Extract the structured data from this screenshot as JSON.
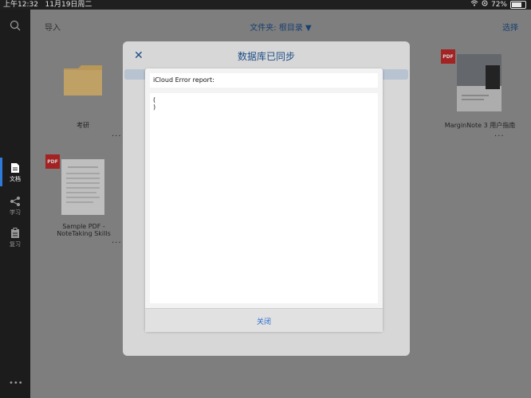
{
  "status_bar": {
    "time": "上午12:32",
    "date": "11月19日周二",
    "battery_percent": "72%",
    "battery_fill_fraction": 0.72
  },
  "sidebar": {
    "items": [
      {
        "label": "文档",
        "icon": "document-icon",
        "active": true
      },
      {
        "label": "学习",
        "icon": "study-icon",
        "active": false
      },
      {
        "label": "复习",
        "icon": "review-icon",
        "active": false
      }
    ]
  },
  "top_bar": {
    "import_label": "导入",
    "folder_label": "文件夹: 根目录 ▼",
    "select_label": "选择"
  },
  "library": {
    "tiles": [
      {
        "title": "考研",
        "more": "···"
      },
      {
        "title": "MarginNote 3 用户指南",
        "badge": "PDF",
        "more": "···"
      },
      {
        "title": "Sample PDF - NoteTaking Skills",
        "badge": "PDF",
        "more": "···"
      }
    ]
  },
  "sync_sheet": {
    "title": "数据库已同步",
    "close_icon": "close-icon"
  },
  "error_alert": {
    "header": "iCloud Error report:",
    "body_lines": [
      "(",
      ")"
    ],
    "close_label": "关闭"
  }
}
